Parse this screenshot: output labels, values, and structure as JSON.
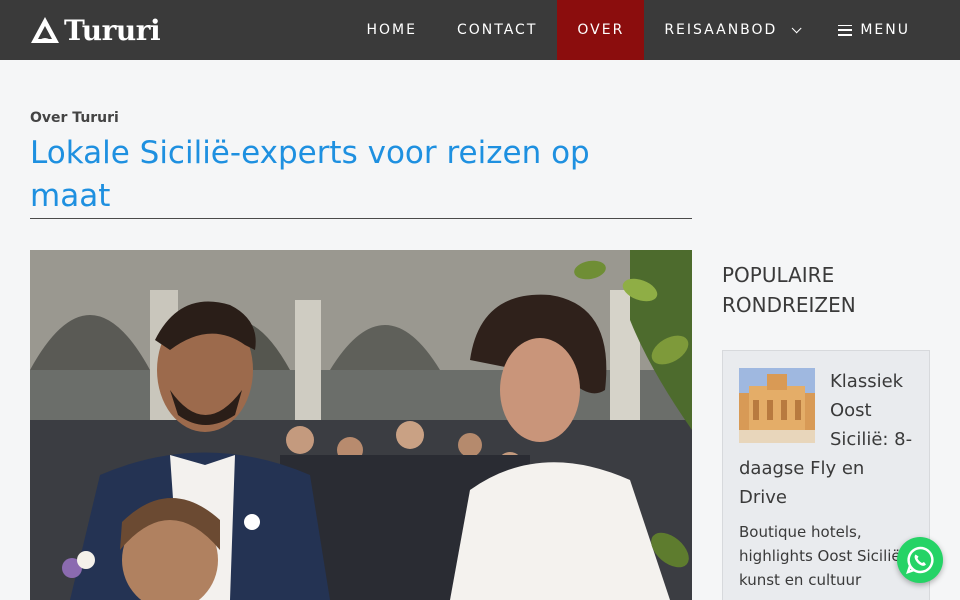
{
  "site": {
    "logo_text": "Tururi"
  },
  "nav": {
    "items": [
      {
        "label": "HOME",
        "active": false
      },
      {
        "label": "CONTACT",
        "active": false
      },
      {
        "label": "OVER",
        "active": true
      },
      {
        "label": "REISAANBOD",
        "active": false
      },
      {
        "label": "MENU",
        "active": false
      }
    ]
  },
  "page": {
    "subtitle": "Over Tururi",
    "title": "Lokale Sicilië-experts voor reizen op maat"
  },
  "sidebar": {
    "heading": "POPULAIRE RONDREIZEN",
    "card": {
      "title": "Klassiek Oost Sicilië: 8-daagse Fly en Drive",
      "description": "Boutique hotels, highlights Oost Sicilië, kunst en cultuur"
    }
  },
  "icons": {
    "logo": "mountain-logo-icon",
    "dropdown": "chevron-down-icon",
    "menu": "hamburger-icon",
    "whatsapp": "whatsapp-icon"
  },
  "colors": {
    "header_bg": "#3a3a3a",
    "active_nav_bg": "#8b0d0d",
    "title_blue": "#1e90e0",
    "whatsapp_green": "#25d366"
  }
}
